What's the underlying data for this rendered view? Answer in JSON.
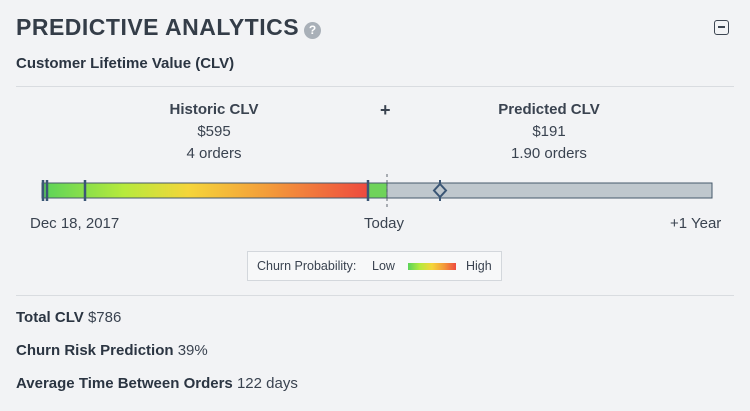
{
  "header": {
    "title": "PREDICTIVE ANALYTICS",
    "help_icon": "question-circle-icon",
    "collapse_icon": "minus-square-icon"
  },
  "subtitle": "Customer Lifetime Value (CLV)",
  "historic": {
    "label": "Historic CLV",
    "value": "$595",
    "orders": "4 orders"
  },
  "plus": "+",
  "predicted": {
    "label": "Predicted CLV",
    "value": "$191",
    "orders": "1.90 orders"
  },
  "timeline": {
    "start_label": "Dec 18, 2017",
    "today_label": "Today",
    "end_label": "+1 Year"
  },
  "legend": {
    "title": "Churn Probability:",
    "low": "Low",
    "high": "High"
  },
  "stats": [
    {
      "label": "Total CLV",
      "value": "$786"
    },
    {
      "label": "Churn Risk Prediction",
      "value": "39%"
    },
    {
      "label": "Average Time Between Orders",
      "value": "122 days"
    }
  ],
  "colors": {
    "low": "#5ad35a",
    "mid": "#f5d53a",
    "high": "#ee4a3f",
    "future": "#bfc7cd",
    "marker": "#3b5675"
  }
}
